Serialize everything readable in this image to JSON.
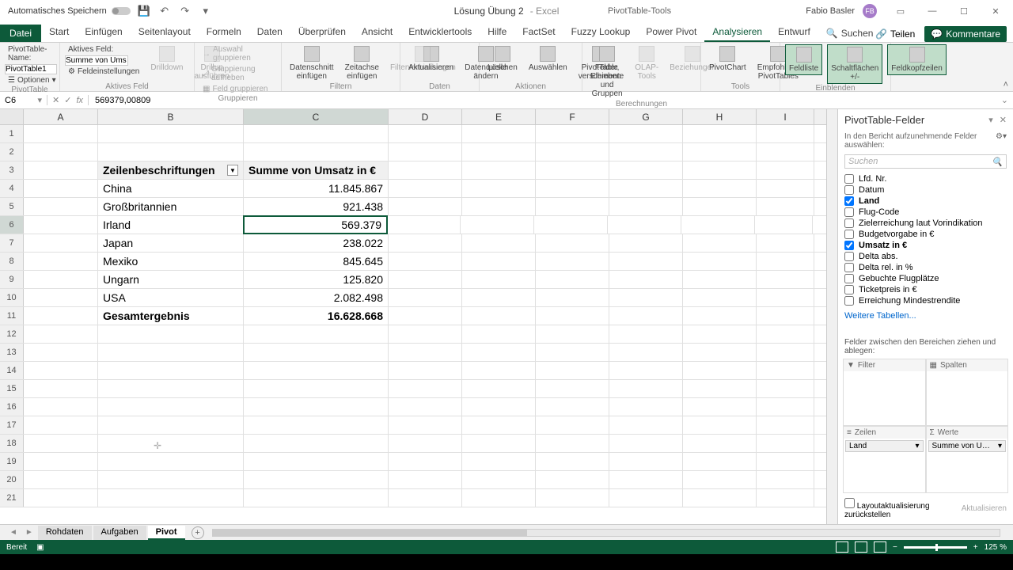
{
  "titlebar": {
    "autosave": "Automatisches Speichern",
    "doc_name": "Lösung Übung 2",
    "app_name": "Excel",
    "context_tools": "PivotTable-Tools",
    "user_name": "Fabio Basler",
    "user_initials": "FB"
  },
  "ribbon": {
    "file": "Datei",
    "tabs": [
      "Start",
      "Einfügen",
      "Seitenlayout",
      "Formeln",
      "Daten",
      "Überprüfen",
      "Ansicht",
      "Entwicklertools",
      "Hilfe",
      "FactSet",
      "Fuzzy Lookup",
      "Power Pivot",
      "Analysieren",
      "Entwurf"
    ],
    "active_tab_index": 12,
    "search": "Suchen",
    "share": "Teilen",
    "comments": "Kommentare",
    "groups": {
      "g_pivot": {
        "name_lbl": "PivotTable-Name:",
        "name_val": "PivotTable1",
        "options": "Optionen",
        "title": "PivotTable"
      },
      "g_activefield": {
        "lbl": "Aktives Feld:",
        "val": "Summe von Ums",
        "settings": "Feldeinstellungen",
        "drilldown": "Drilldown",
        "drillup": "Drillup ausführen",
        "expand": "Feld erweitern",
        "collapse": "Feld reduzieren",
        "title": "Aktives Feld"
      },
      "g_group": {
        "sel": "Auswahl gruppieren",
        "ungroup": "Gruppierung aufheben",
        "field": "Feld gruppieren",
        "title": "Gruppieren"
      },
      "g_filter": {
        "slicer": "Datenschnitt einfügen",
        "timeline": "Zeitachse einfügen",
        "conn": "Filterverbindungen",
        "title": "Filtern"
      },
      "g_data": {
        "refresh": "Aktualisieren",
        "change": "Datenquelle ändern",
        "title": "Daten"
      },
      "g_actions": {
        "clear": "Löschen",
        "select": "Auswählen",
        "move": "PivotTable verschieben",
        "title": "Aktionen"
      },
      "g_calc": {
        "fields": "Felder, Elemente und Gruppen",
        "olap": "OLAP-Tools",
        "rel": "Beziehungen",
        "title": "Berechnungen"
      },
      "g_tools": {
        "chart": "PivotChart",
        "recommend": "Empfohlene PivotTables",
        "title": "Tools"
      },
      "g_show": {
        "fieldlist": "Feldliste",
        "buttons": "Schaltflächen +/-",
        "headers": "Feldkopfzeilen",
        "title": "Einblenden"
      }
    }
  },
  "namebox": "C6",
  "formula": "569379,00809",
  "columns": [
    "A",
    "B",
    "C",
    "D",
    "E",
    "F",
    "G",
    "H",
    "I"
  ],
  "selected_col": "C",
  "selected_row": 6,
  "pivot": {
    "row_header": "Zeilenbeschriftungen",
    "val_header": "Summe von Umsatz in €",
    "rows": [
      {
        "label": "China",
        "val": "11.845.867"
      },
      {
        "label": "Großbritannien",
        "val": "921.438"
      },
      {
        "label": "Irland",
        "val": "569.379"
      },
      {
        "label": "Japan",
        "val": "238.022"
      },
      {
        "label": "Mexiko",
        "val": "845.645"
      },
      {
        "label": "Ungarn",
        "val": "125.820"
      },
      {
        "label": "USA",
        "val": "2.082.498"
      }
    ],
    "total_label": "Gesamtergebnis",
    "total_val": "16.628.668"
  },
  "fieldpane": {
    "title": "PivotTable-Felder",
    "subtitle": "In den Bericht aufzunehmende Felder auswählen:",
    "search_ph": "Suchen",
    "fields": [
      {
        "name": "Lfd. Nr.",
        "checked": false
      },
      {
        "name": "Datum",
        "checked": false
      },
      {
        "name": "Land",
        "checked": true
      },
      {
        "name": "Flug-Code",
        "checked": false
      },
      {
        "name": "Zielerreichung laut Vorindikation",
        "checked": false
      },
      {
        "name": "Budgetvorgabe in €",
        "checked": false
      },
      {
        "name": "Umsatz in €",
        "checked": true
      },
      {
        "name": "Delta abs.",
        "checked": false
      },
      {
        "name": "Delta rel. in %",
        "checked": false
      },
      {
        "name": "Gebuchte Flugplätze",
        "checked": false
      },
      {
        "name": "Ticketpreis in €",
        "checked": false
      },
      {
        "name": "Erreichung Mindestrendite",
        "checked": false
      }
    ],
    "more_tables": "Weitere Tabellen...",
    "drag_label": "Felder zwischen den Bereichen ziehen und ablegen:",
    "area_filter": "Filter",
    "area_cols": "Spalten",
    "area_rows": "Zeilen",
    "area_vals": "Werte",
    "row_item": "Land",
    "val_item": "Summe von Umsatz in €",
    "defer": "Layoutaktualisierung zurückstellen",
    "update": "Aktualisieren"
  },
  "sheets": {
    "tabs": [
      "Rohdaten",
      "Aufgaben",
      "Pivot"
    ],
    "active_index": 2
  },
  "statusbar": {
    "ready": "Bereit",
    "zoom": "125 %"
  }
}
